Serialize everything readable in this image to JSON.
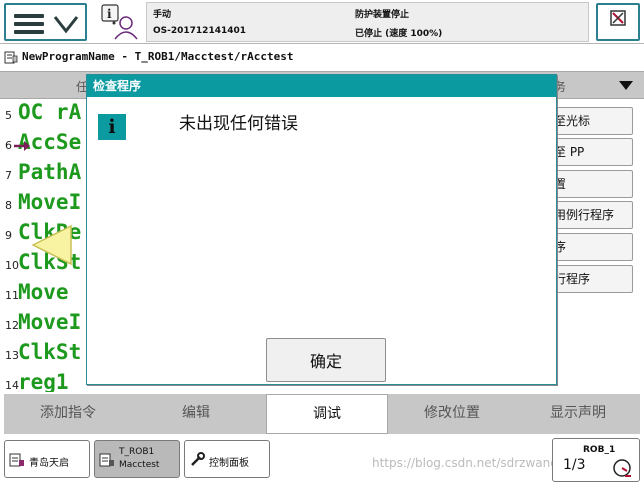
{
  "status": {
    "mode": "手动",
    "controller": "OS-201712141401",
    "safety": "防护装置停止",
    "state": "已停止 (速度 100%)"
  },
  "path": {
    "text": "NewProgramName - T_ROB1/Macctest/rAcctest"
  },
  "editor": {
    "tab_left": "任",
    "tab_right": "务"
  },
  "code_lines": [
    {
      "num": "5",
      "text": "OC rA"
    },
    {
      "num": "6",
      "text": "AccSe"
    },
    {
      "num": "7",
      "text": "PathA"
    },
    {
      "num": "8",
      "text": "MoveI"
    },
    {
      "num": "9",
      "text": "ClkRe"
    },
    {
      "num": "10",
      "text": "ClkSt"
    },
    {
      "num": "11",
      "text": " Move"
    },
    {
      "num": "12",
      "text": "MoveI"
    },
    {
      "num": "13",
      "text": "ClkSt"
    },
    {
      "num": "14",
      "text": "reg1"
    }
  ],
  "side_buttons": [
    "至光标",
    "至 PP",
    "置",
    "用例行程序",
    "序",
    "行程序"
  ],
  "command_bar": {
    "add_instruction": "添加指令",
    "edit": "编辑",
    "debug": "调试",
    "modify_position": "修改位置",
    "show_declaration": "显示声明"
  },
  "taskbar": {
    "task1": "青岛天启",
    "task2_line1": "T_ROB1",
    "task2_line2": "Macctest",
    "task3": "控制面板",
    "quickset_rob": "ROB_1",
    "quickset_frac": "1/3",
    "watermark": "https://blog.csdn.net/sdrzwangyuna"
  },
  "modal": {
    "title": "检查程序",
    "message": "未出现任何错误",
    "ok_label": "确定"
  },
  "colors": {
    "accent_teal": "#0a9aa0",
    "code_green": "#1d9a1d"
  }
}
